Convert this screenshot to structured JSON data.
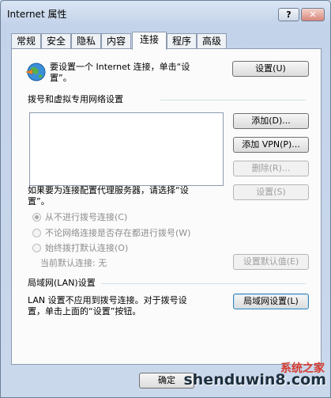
{
  "window": {
    "title": "Internet 属性",
    "help_glyph": "?",
    "close_glyph": "✕"
  },
  "tabs": [
    {
      "label": "常规"
    },
    {
      "label": "安全"
    },
    {
      "label": "隐私"
    },
    {
      "label": "内容"
    },
    {
      "label": "连接",
      "active": true
    },
    {
      "label": "程序"
    },
    {
      "label": "高级"
    }
  ],
  "setup": {
    "text_line1": "要设置一个 Internet 连接，单击“设",
    "text_line2": "置”。",
    "button": "设置(U)",
    "icon": "globe-icon"
  },
  "dialup": {
    "group_label": "拨号和虚拟专用网络设置",
    "add_button": "添加(D)...",
    "add_vpn_button": "添加 VPN(P)...",
    "delete_button": "删除(R)...",
    "proxy_text_line1": "如果要为连接配置代理服务器，请选择“设",
    "proxy_text_line2": "置”。",
    "settings_button": "设置(S)",
    "radio_options": [
      {
        "label": "从不进行拨号连接(C)",
        "checked": true
      },
      {
        "label": "不论网络连接是否存在都进行拨号(W)",
        "checked": false
      },
      {
        "label": "始终拨打默认连接(O)",
        "checked": false
      }
    ],
    "current_default_label": "当前默认连接:",
    "current_default_value": "无",
    "set_default_button": "设置默认值(E)"
  },
  "lan": {
    "group_label": "局域网(LAN)设置",
    "text_line1": "LAN 设置不应用到拨号连接。对于拨号设",
    "text_line2": "置，单击上面的“设置”按钮。",
    "button": "局域网设置(L)"
  },
  "footer": {
    "ok_button": "确定"
  },
  "watermark": {
    "text": "shenduwin8.com",
    "cn": "系统之家"
  }
}
